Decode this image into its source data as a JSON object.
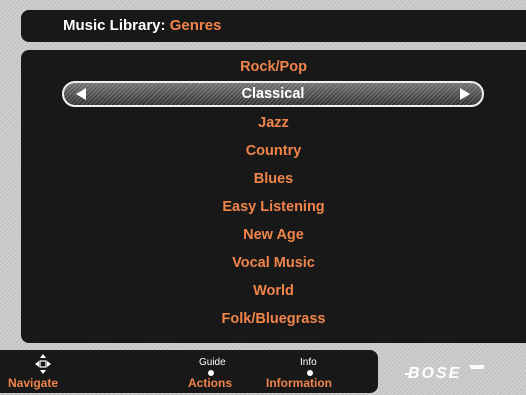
{
  "header": {
    "prefix": "Music Library:",
    "value": "Genres"
  },
  "genres": {
    "items": [
      "Rock/Pop",
      "Classical",
      "Jazz",
      "Country",
      "Blues",
      "Easy Listening",
      "New Age",
      "Vocal Music",
      "World",
      "Folk/Bluegrass"
    ],
    "selected": "Classical",
    "left_arrow_icon": "left-triangle-icon",
    "right_arrow_icon": "right-triangle-icon"
  },
  "footer": {
    "navigate": {
      "label": "Navigate",
      "icon": "directional-pad-icon"
    },
    "actions": {
      "hint": "Guide",
      "label": "Actions",
      "icon": "dot-icon"
    },
    "information": {
      "hint": "Info",
      "label": "Information",
      "icon": "dot-icon"
    }
  },
  "logo": {
    "text": "BOSE"
  },
  "colors": {
    "accent": "#f0844a",
    "panel": "#181818",
    "background": "#c4c4c4",
    "text": "#ffffff"
  }
}
